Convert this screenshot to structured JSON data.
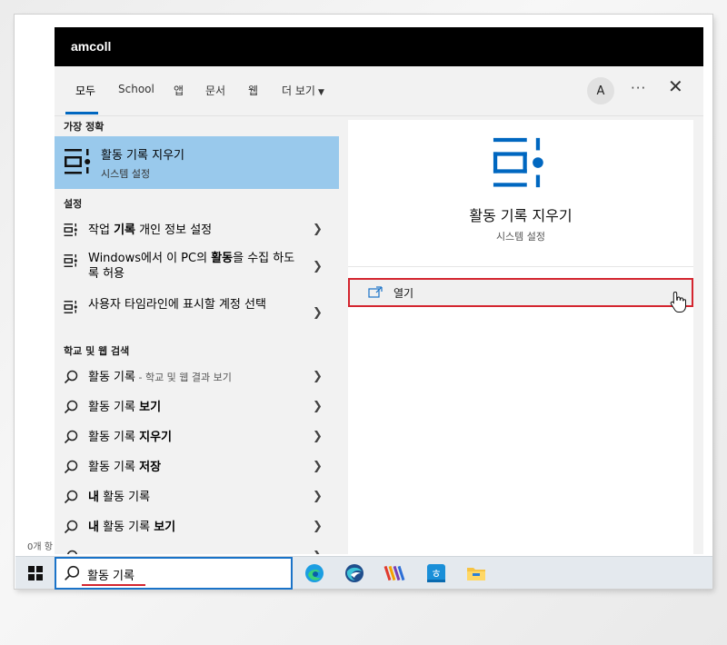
{
  "window": {
    "title": "amcoll"
  },
  "tabs": [
    {
      "label": "모두"
    },
    {
      "label": "School"
    },
    {
      "label": "앱"
    },
    {
      "label": "문서"
    },
    {
      "label": "웹"
    },
    {
      "label": "더 보기"
    }
  ],
  "header": {
    "avatar_letter": "A",
    "more_options": "···",
    "close": "✕"
  },
  "sections": {
    "best_match": "가장 정확",
    "settings": "설정",
    "web": "학교 및 웹 검색"
  },
  "best_match": {
    "title": "활동 기록 지우기",
    "subtitle": "시스템 설정"
  },
  "settings_items": [
    {
      "pre": "작업 ",
      "bold": "기록",
      "post": " 개인 정보 설정"
    },
    {
      "pre": "Windows에서 이 PC의 ",
      "bold": "활동",
      "post": "을 수집 하도록 허용"
    },
    {
      "pre": "사용자 타임라인에 표시할 계정 선택",
      "bold": "",
      "post": ""
    }
  ],
  "web_items": [
    {
      "pre": "활동 기록",
      "bold": "",
      "suffix": " - 학교 및 웹 결과 보기"
    },
    {
      "pre": "활동 기록 ",
      "bold": "보기",
      "suffix": ""
    },
    {
      "pre": "활동 기록 ",
      "bold": "지우기",
      "suffix": ""
    },
    {
      "pre": "활동 기록 ",
      "bold": "저장",
      "suffix": ""
    },
    {
      "pre": "",
      "bold": "내",
      "post": " 활동 기록",
      "suffix": ""
    },
    {
      "pre": "",
      "bold": "내",
      "post": " 활동 기록 ",
      "bold2": "보기",
      "suffix": ""
    }
  ],
  "detail": {
    "title": "활동 기록 지우기",
    "subtitle": "시스템 설정",
    "open_label": "열기"
  },
  "taskbar": {
    "search_text": "활동 기록",
    "apps": [
      "edge-icon",
      "app2-icon",
      "app3-icon",
      "hwp-icon",
      "file-explorer-icon"
    ]
  },
  "background": {
    "partial_text": "0개 항"
  },
  "colors": {
    "accent": "#0067c0",
    "selection": "#99c9ec",
    "highlight_border": "#d4252f",
    "titlebar": "#000000"
  }
}
